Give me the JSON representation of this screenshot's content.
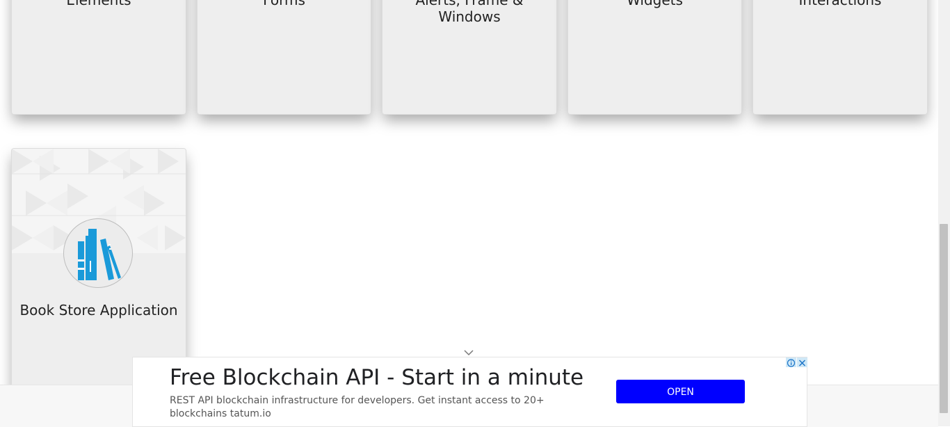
{
  "cards": {
    "elements": {
      "title": "Elements"
    },
    "forms": {
      "title": "Forms"
    },
    "alerts": {
      "title_line1": "Alerts, Frame &",
      "title_line2": "Windows"
    },
    "widgets": {
      "title": "Widgets"
    },
    "interactions": {
      "title": "Interactions"
    },
    "book_store": {
      "title": "Book Store Application",
      "icon": "books-icon"
    }
  },
  "ad": {
    "headline": "Free Blockchain API - Start in a minute",
    "description": "REST API blockchain infrastructure for developers. Get instant access to 20+ blockchains tatum.io",
    "button_label": "OPEN",
    "button_color": "#0000ff",
    "info_icon": "info-icon",
    "close_icon": "close-icon"
  },
  "colors": {
    "card_bg": "#eeeeee",
    "book_icon": "#1a9ad9"
  }
}
